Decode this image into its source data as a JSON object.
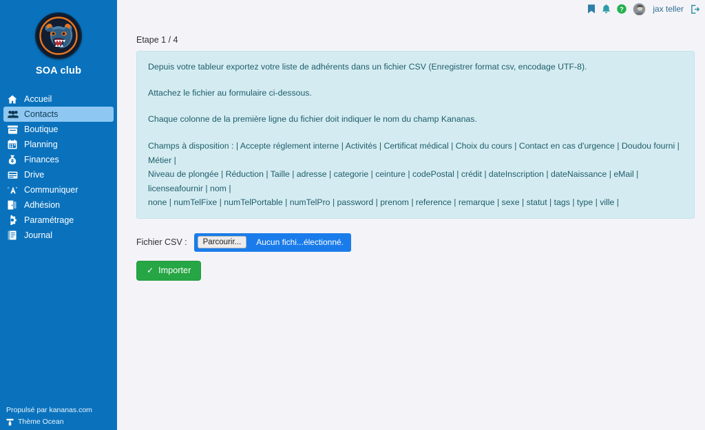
{
  "brand": {
    "name": "SOA club",
    "logo_alt": "bear-mascot-logo"
  },
  "sidebar": {
    "items": [
      {
        "label": "Accueil",
        "icon": "home-icon",
        "active": false
      },
      {
        "label": "Contacts",
        "icon": "users-icon",
        "active": true
      },
      {
        "label": "Boutique",
        "icon": "store-icon",
        "active": false
      },
      {
        "label": "Planning",
        "icon": "calendar-icon",
        "active": false
      },
      {
        "label": "Finances",
        "icon": "money-bag-icon",
        "active": false
      },
      {
        "label": "Drive",
        "icon": "drive-icon",
        "active": false
      },
      {
        "label": "Communiquer",
        "icon": "megaphone-icon",
        "active": false
      },
      {
        "label": "Adhésion",
        "icon": "door-icon",
        "active": false
      },
      {
        "label": "Paramétrage",
        "icon": "gear-icon",
        "active": false
      },
      {
        "label": "Journal",
        "icon": "book-icon",
        "active": false
      }
    ],
    "footer": {
      "powered_by": "Propulsé par kananas.com",
      "theme": "Thème Ocean",
      "theme_icon": "paint-roller-icon"
    }
  },
  "topbar": {
    "bookmark_icon": "bookmark-icon",
    "bell_icon": "bell-icon",
    "help_icon": "help-circle-icon",
    "avatar_icon": "user-avatar",
    "username": "jax teller",
    "logout_icon": "logout-icon"
  },
  "main": {
    "step": "Etape 1 / 4",
    "alert": {
      "line1": "Depuis votre tableur exportez votre liste de adhérents dans un fichier CSV (Enregistrer format csv, encodage UTF-8).",
      "line2": "Attachez le fichier au formulaire ci-dessous.",
      "line3": "Chaque colonne de la première ligne du fichier doit indiquer le nom du champ Kananas.",
      "fields_intro": "Champs à disposition :",
      "fields_line1": "Champs à disposition : | Accepte réglement interne | Activités | Certificat médical | Choix du cours | Contact en cas d'urgence | Doudou fourni | Métier |",
      "fields_line2": "Niveau de plongée | Réduction | Taille | adresse | categorie | ceinture | codePostal | crédit | dateInscription | dateNaissance | eMail | licenseafournir | nom |",
      "fields_line3": "none | numTelFixe | numTelPortable | numTelPro | password | prenom | reference | remarque | sexe | statut | tags | type | ville |"
    },
    "form": {
      "file_label": "Fichier CSV :",
      "browse_button": "Parcourir...",
      "file_status": "Aucun fichi...électionné.",
      "submit_button": "Importer",
      "submit_icon": "check-icon"
    }
  },
  "colors": {
    "sidebar_bg": "#0a72bd",
    "sidebar_active_bg": "#8ec8f2",
    "page_bg": "#f4f4f8",
    "alert_bg": "#d4ecf1",
    "alert_text": "#1d5c6b",
    "file_input_bg": "#1a7cea",
    "submit_green": "#26a644",
    "accent_teal": "#2f8fa8",
    "help_green": "#22b14c"
  }
}
